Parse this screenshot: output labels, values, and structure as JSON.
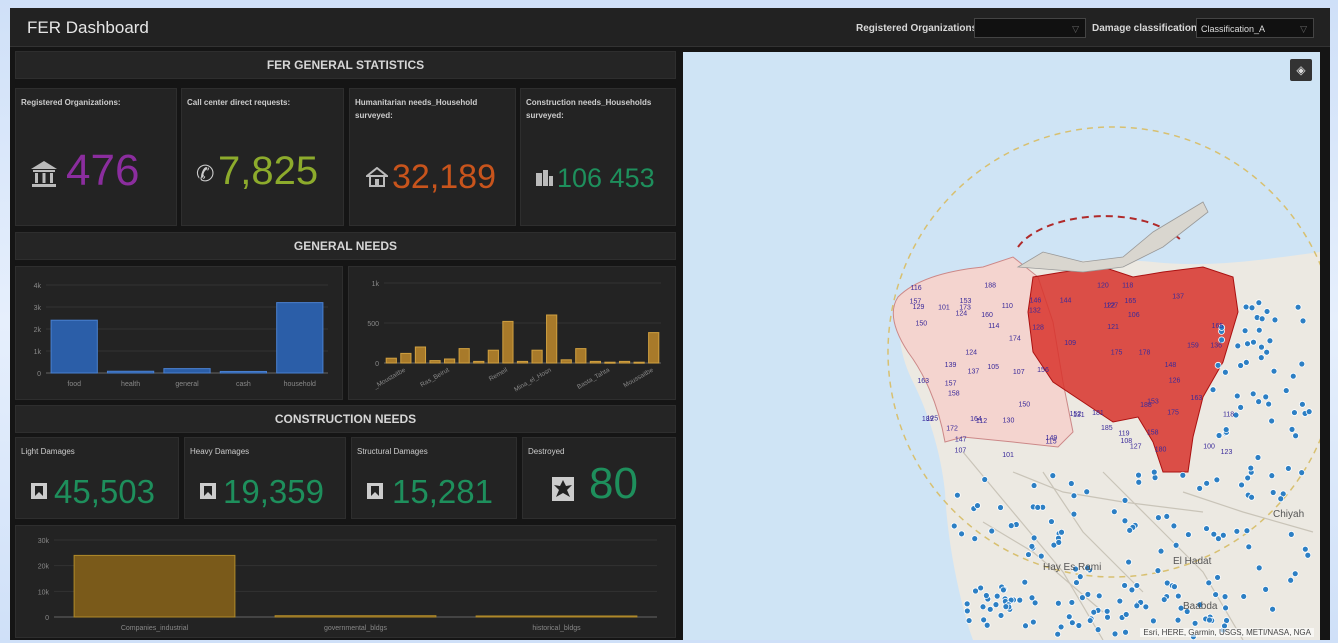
{
  "header": {
    "title": "FER Dashboard",
    "filter_orgs_label": "Registered Organizations:",
    "filter_orgs_value": "",
    "filter_damage_label": "Damage classification :",
    "filter_damage_value": "Classification_A"
  },
  "stats": {
    "title": "FER GENERAL STATISTICS",
    "cards": [
      {
        "label": "Registered Organizations:",
        "value": "476",
        "color": "#8b2d9e",
        "icon": "institution-icon"
      },
      {
        "label": "Call center direct requests:",
        "value": "7,825",
        "color": "#8dab2c",
        "icon": "phone-icon"
      },
      {
        "label": "Humanitarian needs_Household surveyed:",
        "value": "32,189",
        "color": "#c8541c",
        "icon": "house-icon"
      },
      {
        "label": "Construction needs_Households surveyed:",
        "value": "106 453",
        "color": "#1e8f5c",
        "icon": "buildings-icon"
      }
    ]
  },
  "needs": {
    "title": "GENERAL NEEDS"
  },
  "construction": {
    "title": "CONSTRUCTION NEEDS",
    "cards": [
      {
        "label": "Light Damages",
        "value": "45,503",
        "color": "#1e8f5c",
        "icon": "damage-icon"
      },
      {
        "label": "Heavy Damages",
        "value": "19,359",
        "color": "#1e8f5c",
        "icon": "damage-icon"
      },
      {
        "label": "Structural Damages",
        "value": "15,281",
        "color": "#1e8f5c",
        "icon": "damage-icon"
      },
      {
        "label": "Destroyed",
        "value": "80",
        "color": "#1e8f5c",
        "icon": "destroyed-icon"
      }
    ]
  },
  "chart_data": [
    {
      "type": "bar",
      "categories": [
        "food",
        "health",
        "general",
        "cash",
        "household"
      ],
      "values": [
        2400,
        80,
        200,
        70,
        3200
      ],
      "ylim": [
        0,
        4000
      ],
      "yticks": [
        "0",
        "1k",
        "2k",
        "3k",
        "4k"
      ],
      "color": "#2b5ea8"
    },
    {
      "type": "bar",
      "categories": [
        "_Moustaitbe",
        "Ras_Beirut",
        "Remeil",
        "Mina_el_Hosn",
        "Basta_Tahta",
        "Moussaitbe"
      ],
      "values": [
        60,
        120,
        200,
        30,
        50,
        180,
        20,
        160,
        520,
        20,
        160,
        600,
        40,
        180,
        20,
        10,
        20,
        10,
        380
      ],
      "tick_positions": [
        1,
        4,
        8,
        11,
        15,
        18
      ],
      "ylim": [
        0,
        1000
      ],
      "yticks": [
        "0",
        "500",
        "1k"
      ],
      "color": "#a87a2a"
    },
    {
      "type": "bar",
      "categories": [
        "Companies_industrial",
        "governmental_bldgs",
        "historical_bldgs"
      ],
      "values": [
        24000,
        500,
        400
      ],
      "ylim": [
        0,
        30000
      ],
      "yticks": [
        "0",
        "10k",
        "20k",
        "30k"
      ],
      "color": "#7a5a1a"
    }
  ],
  "map": {
    "attribution": "Esri, HERE, Garmin, USGS, METI/NASA, NGA",
    "place_labels": [
      "Hay Es Rami",
      "El Hadat",
      "Baabda",
      "Chiyah"
    ]
  }
}
